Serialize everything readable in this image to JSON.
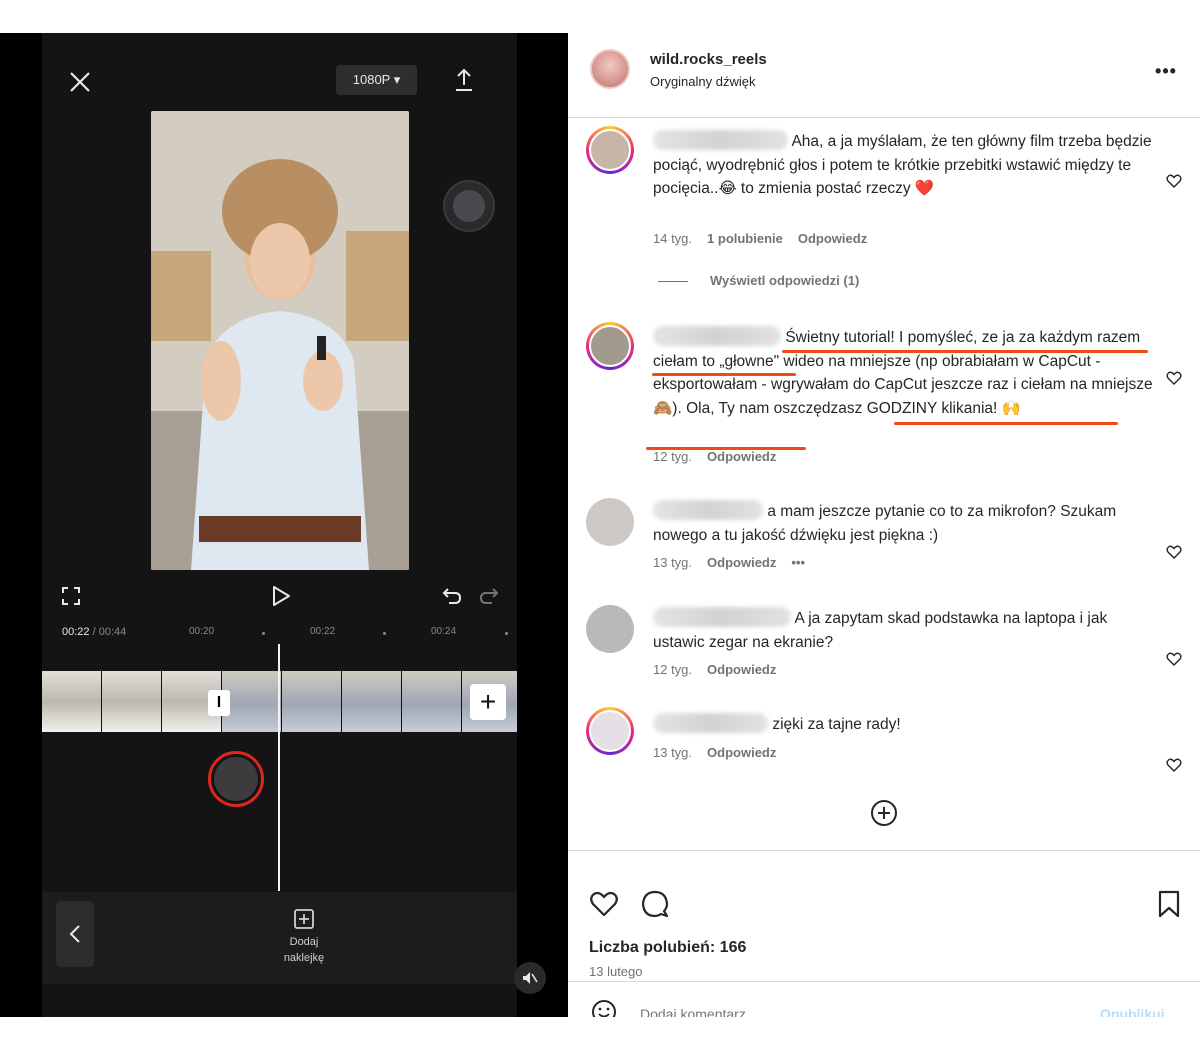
{
  "editor": {
    "resolution": "1080P ▾",
    "timecode_current": "00:22",
    "timecode_total": "/ 00:44",
    "ticks": [
      "00:20",
      "00:22",
      "00:24"
    ],
    "bottom_add_sticker": "Dodaj naklejkę",
    "icons": {
      "close": "close-icon",
      "export": "export-icon",
      "fullscreen": "fullscreen-icon",
      "play": "play-icon",
      "undo": "undo-icon",
      "redo": "redo-icon",
      "add_clip": "plus-icon",
      "back": "chevron-left-icon",
      "sticker": "add-sticker-icon",
      "mute": "mute-icon"
    }
  },
  "instagram": {
    "username": "wild.rocks_reels",
    "audio": "Oryginalny dźwięk",
    "more": "•••",
    "comments": [
      {
        "text": "Aha, a ja myślałam, że ten główny film trzeba będzie pociąć, wyodrębnić głos i potem te krótkie przebitki wstawić między te pocięcia..😂 to zmienia postać rzeczy ❤️",
        "age": "14 tyg.",
        "likes": "1 polubienie",
        "reply": "Odpowiedz"
      },
      {
        "text": "Świetny tutorial! I pomyśleć, ze ja za każdym razem ciełam to „głowne\" wideo na mniejsze (np obrabiałam w CapCut - eksportowałam - wgrywałam do CapCut jeszcze raz i ciełam na mniejsze 🙈). Ola, Ty nam oszczędzasz GODZINY klikania! 🙌",
        "age": "12 tyg.",
        "reply": "Odpowiedz"
      },
      {
        "text": "a mam jeszcze pytanie co to za mikrofon? Szukam nowego a tu jakość dźwięku jest piękna :)",
        "age": "13 tyg.",
        "reply": "Odpowiedz",
        "more": "•••"
      },
      {
        "text": "A ja zapytam skad podstawka na laptopa i jak ustawic zegar na ekranie?",
        "age": "12 tyg.",
        "reply": "Odpowiedz"
      },
      {
        "text": "zięki za tajne rady!",
        "age": "13 tyg.",
        "reply": "Odpowiedz"
      }
    ],
    "view_replies": "Wyświetl odpowiedzi (1)",
    "likes_label": "Liczba polubień: 166",
    "date": "13 lutego",
    "add_comment_placeholder": "Dodaj komentarz...",
    "publish": "Opublikuj",
    "accent_color": "#f04a18",
    "icons": {
      "heart": "heart-icon",
      "comment": "comment-icon",
      "bookmark": "bookmark-icon",
      "load_more": "plus-circle-icon",
      "emoji": "emoji-icon"
    }
  }
}
